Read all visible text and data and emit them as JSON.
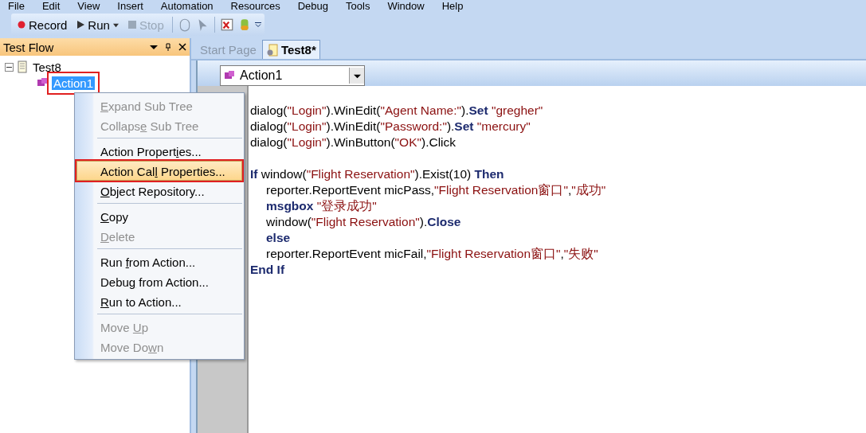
{
  "menu_bar": [
    "File",
    "Edit",
    "View",
    "Insert",
    "Automation",
    "Resources",
    "Debug",
    "Tools",
    "Window",
    "Help"
  ],
  "toolbar": [
    {
      "kind": "record",
      "label": "Record",
      "disabled": false
    },
    {
      "kind": "run",
      "label": "Run",
      "disabled": false
    },
    {
      "kind": "stop",
      "label": "Stop",
      "disabled": true
    }
  ],
  "test_flow": {
    "title": "Test Flow",
    "tree": [
      {
        "label": "Test8",
        "expanded": true,
        "selected": false,
        "annotated": false,
        "children": [
          {
            "label": "Action1",
            "selected": true,
            "annotated": true
          }
        ]
      }
    ]
  },
  "tabs": [
    {
      "label": "Start Page",
      "selected": false
    },
    {
      "label": "Test8*",
      "selected": true
    }
  ],
  "action_dropdown": {
    "value": "Action1"
  },
  "code": [
    {
      "kind": "code",
      "indented": false,
      "tokens": [
        {
          "kind": "plain",
          "text": "dialog("
        },
        {
          "kind": "string",
          "text": "\"Login\""
        },
        {
          "kind": "plain",
          "text": ").WinEdit("
        },
        {
          "kind": "string",
          "text": "\"Agent Name:\""
        },
        {
          "kind": "plain",
          "text": ")."
        },
        {
          "kind": "keyword",
          "text": "Set"
        },
        {
          "kind": "string",
          "text": " \"gregher\""
        }
      ]
    },
    {
      "kind": "code",
      "indented": false,
      "tokens": [
        {
          "kind": "plain",
          "text": "dialog("
        },
        {
          "kind": "string",
          "text": "\"Login\""
        },
        {
          "kind": "plain",
          "text": ").WinEdit("
        },
        {
          "kind": "string",
          "text": "\"Password:\""
        },
        {
          "kind": "plain",
          "text": ")."
        },
        {
          "kind": "keyword",
          "text": "Set"
        },
        {
          "kind": "string",
          "text": " \"mercury\""
        }
      ]
    },
    {
      "kind": "code",
      "indented": false,
      "tokens": [
        {
          "kind": "plain",
          "text": "dialog("
        },
        {
          "kind": "string",
          "text": "\"Login\""
        },
        {
          "kind": "plain",
          "text": ").WinButton("
        },
        {
          "kind": "string",
          "text": "\"OK\""
        },
        {
          "kind": "plain",
          "text": ").Click"
        }
      ]
    },
    {
      "kind": "blank"
    },
    {
      "kind": "code",
      "indented": false,
      "tokens": [
        {
          "kind": "keyword",
          "text": "If"
        },
        {
          "kind": "plain",
          "text": " window("
        },
        {
          "kind": "string",
          "text": "\"Flight Reservation\""
        },
        {
          "kind": "plain",
          "text": ").Exist(10) "
        },
        {
          "kind": "keyword",
          "text": "Then"
        }
      ]
    },
    {
      "kind": "code",
      "indented": true,
      "tokens": [
        {
          "kind": "plain",
          "text": "reporter.ReportEvent micPass,"
        },
        {
          "kind": "string",
          "text": "\"Flight Reservation窗口\""
        },
        {
          "kind": "plain",
          "text": ","
        },
        {
          "kind": "string",
          "text": "\"成功\""
        }
      ]
    },
    {
      "kind": "code",
      "indented": true,
      "tokens": [
        {
          "kind": "keyword",
          "text": "msgbox"
        },
        {
          "kind": "string",
          "text": " \"登录成功\""
        }
      ]
    },
    {
      "kind": "code",
      "indented": true,
      "tokens": [
        {
          "kind": "plain",
          "text": "window("
        },
        {
          "kind": "string",
          "text": "\"Flight Reservation\""
        },
        {
          "kind": "plain",
          "text": ")."
        },
        {
          "kind": "keyword",
          "text": "Close"
        }
      ]
    },
    {
      "kind": "code",
      "indented": true,
      "tokens": [
        {
          "kind": "keyword",
          "text": "else"
        }
      ]
    },
    {
      "kind": "code",
      "indented": true,
      "tokens": [
        {
          "kind": "plain",
          "text": "reporter.ReportEvent micFail,"
        },
        {
          "kind": "string",
          "text": "\"Flight Reservation窗口\""
        },
        {
          "kind": "plain",
          "text": ","
        },
        {
          "kind": "string",
          "text": "\"失败\""
        }
      ]
    },
    {
      "kind": "code",
      "indented": false,
      "tokens": [
        {
          "kind": "keyword",
          "text": "End If"
        }
      ]
    }
  ],
  "context_menu": [
    {
      "kind": "item",
      "label": {
        "key": "E",
        "after": "xpand Sub Tree"
      },
      "disabled": true,
      "selected": false,
      "annotated": false
    },
    {
      "kind": "item",
      "label": {
        "before": "Collaps",
        "key": "e",
        "after": " Sub Tree"
      },
      "disabled": true,
      "selected": false,
      "annotated": false
    },
    {
      "kind": "separator"
    },
    {
      "kind": "item",
      "label": {
        "before": "Action Propert",
        "key": "i",
        "after": "es..."
      },
      "disabled": false,
      "selected": false,
      "annotated": false
    },
    {
      "kind": "item",
      "label": {
        "before": "Action Cal",
        "key": "l",
        "after": " Properties..."
      },
      "disabled": false,
      "selected": true,
      "annotated": true
    },
    {
      "kind": "item",
      "label": {
        "key": "O",
        "after": "bject Repository..."
      },
      "disabled": false,
      "selected": false,
      "annotated": false
    },
    {
      "kind": "separator"
    },
    {
      "kind": "item",
      "label": {
        "key": "C",
        "after": "opy"
      },
      "disabled": false,
      "selected": false,
      "annotated": false
    },
    {
      "kind": "item",
      "label": {
        "key": "D",
        "after": "elete"
      },
      "disabled": true,
      "selected": false,
      "annotated": false
    },
    {
      "kind": "separator"
    },
    {
      "kind": "item",
      "label": {
        "before": "Run ",
        "key": "f",
        "after": "rom Action..."
      },
      "disabled": false,
      "selected": false,
      "annotated": false
    },
    {
      "kind": "item",
      "label": {
        "before": "Debu",
        "key": "g",
        "after": " from Action..."
      },
      "disabled": false,
      "selected": false,
      "annotated": false
    },
    {
      "kind": "item",
      "label": {
        "key": "R",
        "after": "un to Action..."
      },
      "disabled": false,
      "selected": false,
      "annotated": false
    },
    {
      "kind": "separator"
    },
    {
      "kind": "item",
      "label": {
        "before": "Move ",
        "key": "U",
        "after": "p"
      },
      "disabled": true,
      "selected": false,
      "annotated": false
    },
    {
      "kind": "item",
      "label": {
        "before": "Move Do",
        "key": "w",
        "after": "n"
      },
      "disabled": true,
      "selected": false,
      "annotated": false
    }
  ]
}
